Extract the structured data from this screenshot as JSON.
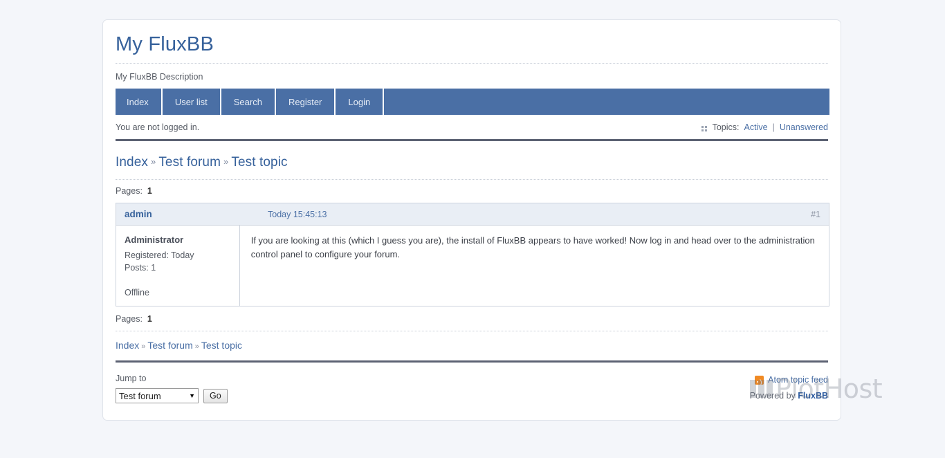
{
  "board": {
    "title": "My FluxBB",
    "description": "My FluxBB Description"
  },
  "nav": {
    "items": [
      {
        "label": "Index"
      },
      {
        "label": "User list"
      },
      {
        "label": "Search"
      },
      {
        "label": "Register"
      },
      {
        "label": "Login"
      }
    ]
  },
  "status": {
    "login_text": "You are not logged in.",
    "grip_icon": "grip-icon",
    "topics_label": "Topics:",
    "active_label": "Active",
    "separator": "|",
    "unanswered_label": "Unanswered"
  },
  "breadcrumb_top": {
    "index": "Index",
    "sep1": "»",
    "forum": "Test forum",
    "sep2": "»",
    "topic": "Test topic"
  },
  "pages_top": {
    "label": "Pages:",
    "number": "1"
  },
  "post": {
    "author": "admin",
    "time": "Today 15:45:13",
    "number": "#1",
    "role": "Administrator",
    "registered": "Registered: Today",
    "posts": "Posts: 1",
    "online_status": "Offline",
    "message": "If you are looking at this (which I guess you are), the install of FluxBB appears to have worked! Now log in and head over to the administration control panel to configure your forum."
  },
  "pages_bottom": {
    "label": "Pages:",
    "number": "1"
  },
  "breadcrumb_bottom": {
    "index": "Index",
    "sep1": "»",
    "forum": "Test forum",
    "sep2": "»",
    "topic": "Test topic"
  },
  "footer": {
    "jump_label": "Jump to",
    "jump_value": "Test forum",
    "jump_arrow": "▼",
    "go_label": "Go",
    "feed_icon": "rss-icon",
    "feed_label": "Atom topic feed",
    "powered_prefix": "Powered by ",
    "powered_brand": "FluxBB"
  },
  "watermark": {
    "text": "PlotHost"
  },
  "colors": {
    "accent": "#4a6fa5",
    "heading": "#36619b",
    "page_bg": "#f4f6fa",
    "nav_bg": "#4a6fa5",
    "post_head_bg": "#e9eef5",
    "rss_orange": "#f08a24"
  }
}
